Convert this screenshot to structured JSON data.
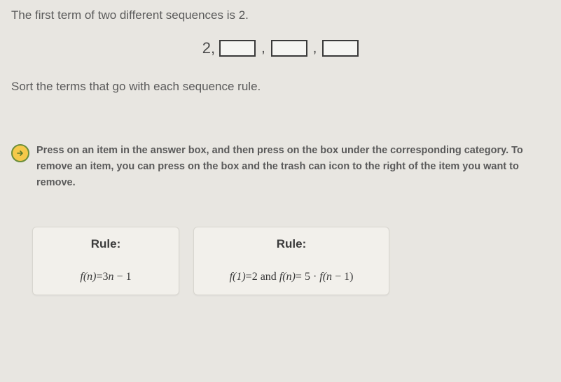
{
  "intro": "The first term of two different sequences is 2.",
  "sequence": {
    "first_term": "2"
  },
  "sort_instruction": "Sort the terms that go with each sequence rule.",
  "hint": "Press on an item in the answer box, and then press on the box under the corresponding category. To remove an item, you can press on the box and the trash can icon to the right of the item you want to remove.",
  "rules": {
    "title": "Rule:",
    "rule1": {
      "formula_lhs": "f(n)",
      "formula_eq": "=",
      "formula_rhs_a": "3",
      "formula_rhs_b": "n",
      "formula_rhs_c": "− 1"
    },
    "rule2": {
      "part1_lhs": "f(1)",
      "part1_eq": "=",
      "part1_rhs": "2",
      "conj": " and ",
      "part2_lhs": "f(n)",
      "part2_eq": "=",
      "part2_rhs_a": " 5 · ",
      "part2_rhs_b": "f(n",
      "part2_rhs_c": "− 1)"
    }
  }
}
